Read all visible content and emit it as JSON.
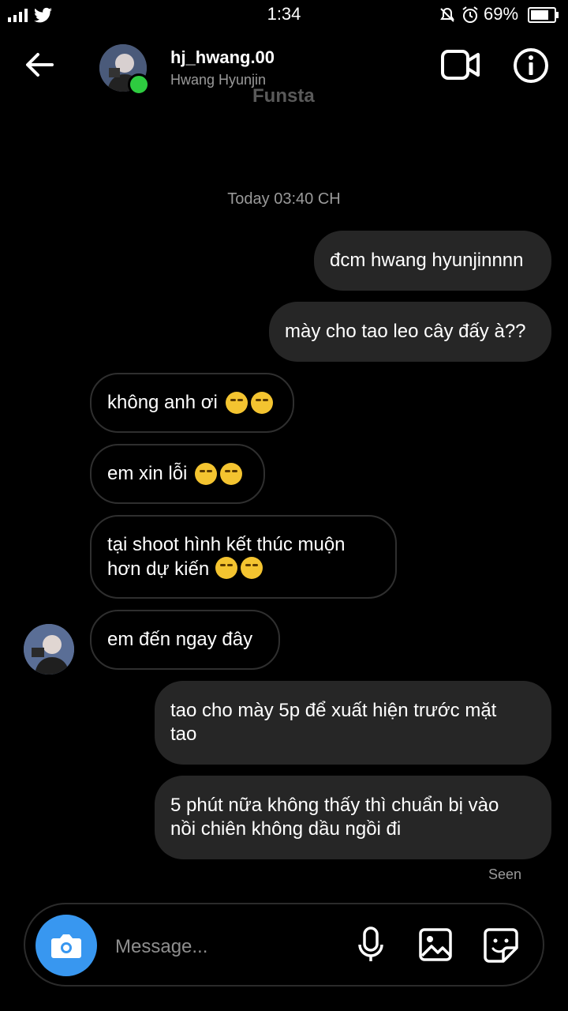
{
  "status_bar": {
    "time": "1:34",
    "battery": "69%"
  },
  "header": {
    "username": "hj_hwang.00",
    "full_name": "Hwang Hyunjin",
    "watermark": "Funsta",
    "online_color": "#2ecc40"
  },
  "chat": {
    "timestamp": "Today 03:40 CH",
    "messages": [
      {
        "from": "me",
        "text": "đcm hwang hyunjinnnn"
      },
      {
        "from": "me",
        "text": "mày cho tao leo cây đấy à??"
      },
      {
        "from": "them",
        "text": "không anh ơi",
        "emoji": "loudly-crying-face x2"
      },
      {
        "from": "them",
        "text": "em xin lỗi",
        "emoji": "loudly-crying-face x2"
      },
      {
        "from": "them",
        "line1": "tại shoot hình kết thúc muộn",
        "line2": "hơn dự kiến",
        "emoji": "loudly-crying-face x2"
      },
      {
        "from": "them",
        "text": "em đến ngay đây"
      },
      {
        "from": "me",
        "line1": "tao cho mày 5p để xuất hiện trước mặt",
        "line2": "tao"
      },
      {
        "from": "me",
        "line1": "5 phút nữa không thấy thì chuẩn bị vào",
        "line2": "nồi chiên không dầu ngồi đi"
      }
    ],
    "seen": "Seen"
  },
  "composer": {
    "placeholder": "Message...",
    "accent": "#3897f0"
  }
}
